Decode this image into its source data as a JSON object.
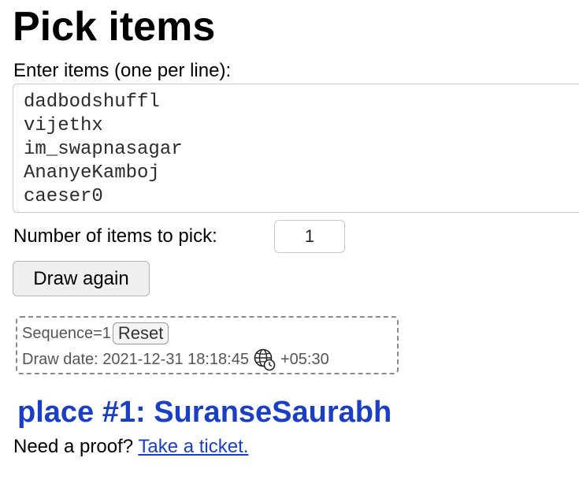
{
  "page": {
    "title": "Pick items"
  },
  "items": {
    "label": "Enter items (one per line):",
    "lines": [
      "dadbodshuffl",
      "vijethx",
      "im_swapnasagar",
      "AnanyeKamboj",
      "caeser0"
    ]
  },
  "pick": {
    "label": "Number of items to pick:",
    "value": "1"
  },
  "draw_button": {
    "label": "Draw again"
  },
  "meta": {
    "sequence_text": "Sequence=1",
    "reset_label": "Reset",
    "draw_date_text": "Draw date: 2021-12-31 18:18:45",
    "timezone_icon": "globe-clock-icon",
    "timezone_offset": "+05:30"
  },
  "result": {
    "text": "place #1: SuranseSaurabh"
  },
  "proof": {
    "prompt": "Need a proof?",
    "link_label": "Take a ticket."
  },
  "colors": {
    "result": "#1a3ec4",
    "link": "#1a3ec4"
  }
}
